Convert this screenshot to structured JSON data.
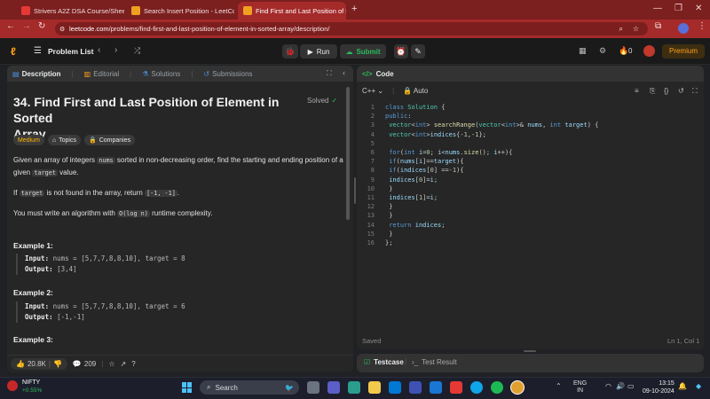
{
  "browser": {
    "tabs": [
      {
        "title": "Strivers A2Z DSA Course/Sheet",
        "fav": "#e53935"
      },
      {
        "title": "Search Insert Position - LeetCo",
        "fav": "#f0a020"
      },
      {
        "title": "Find First and Last Position of E",
        "fav": "#f0a020"
      }
    ],
    "url_domain": "leetcode.com",
    "url_path": "/problems/find-first-and-last-position-of-element-in-sorted-array/description/",
    "new_tab": "+"
  },
  "leetcode": {
    "problem_list": "Problem List",
    "run": "Run",
    "submit": "Submit",
    "streak": "0",
    "premium": "Premium"
  },
  "left": {
    "tabs": [
      "Description",
      "Editorial",
      "Solutions",
      "Submissions"
    ],
    "title_line1": "34. Find First and Last Position of Element in Sorted",
    "title_line2": "Array",
    "solved": "Solved",
    "difficulty": "Medium",
    "topics": "Topics",
    "companies": "Companies",
    "p1_a": "Given an array of integers",
    "p1_code1": "nums",
    "p1_b": "sorted in non-decreasing order, find the starting and ending position",
    "p1_c": "of a given",
    "p1_code2": "target",
    "p1_d": "value.",
    "p2_a": "If",
    "p2_code1": "target",
    "p2_b": "is not found in the array, return",
    "p2_code2": "[-1, -1]",
    "p2_c": ".",
    "p3_a": "You must write an algorithm with",
    "p3_code": "O(log n)",
    "p3_b": "runtime complexity.",
    "ex1_title": "Example 1:",
    "ex1_input_label": "Input:",
    "ex1_input": "nums = [5,7,7,8,8,10], target = 8",
    "ex1_output_label": "Output:",
    "ex1_output": "[3,4]",
    "ex2_title": "Example 2:",
    "ex2_input_label": "Input:",
    "ex2_input": "nums = [5,7,7,8,8,10], target = 6",
    "ex2_output_label": "Output:",
    "ex2_output": "[-1,-1]",
    "ex3_title": "Example 3:",
    "likes": "20.8K",
    "comments": "209"
  },
  "right": {
    "tab": "Code",
    "lang": "C++",
    "auto": "Auto",
    "saved": "Saved",
    "cursor": "Ln 1, Col 1",
    "testcase": "Testcase",
    "test_result": "Test Result"
  },
  "taskbar": {
    "nifty": "NIFTY",
    "nifty_change": "+0.55%",
    "search": "Search",
    "lang1": "ENG",
    "lang2": "IN",
    "time": "13:15",
    "date": "09-10-2024"
  }
}
